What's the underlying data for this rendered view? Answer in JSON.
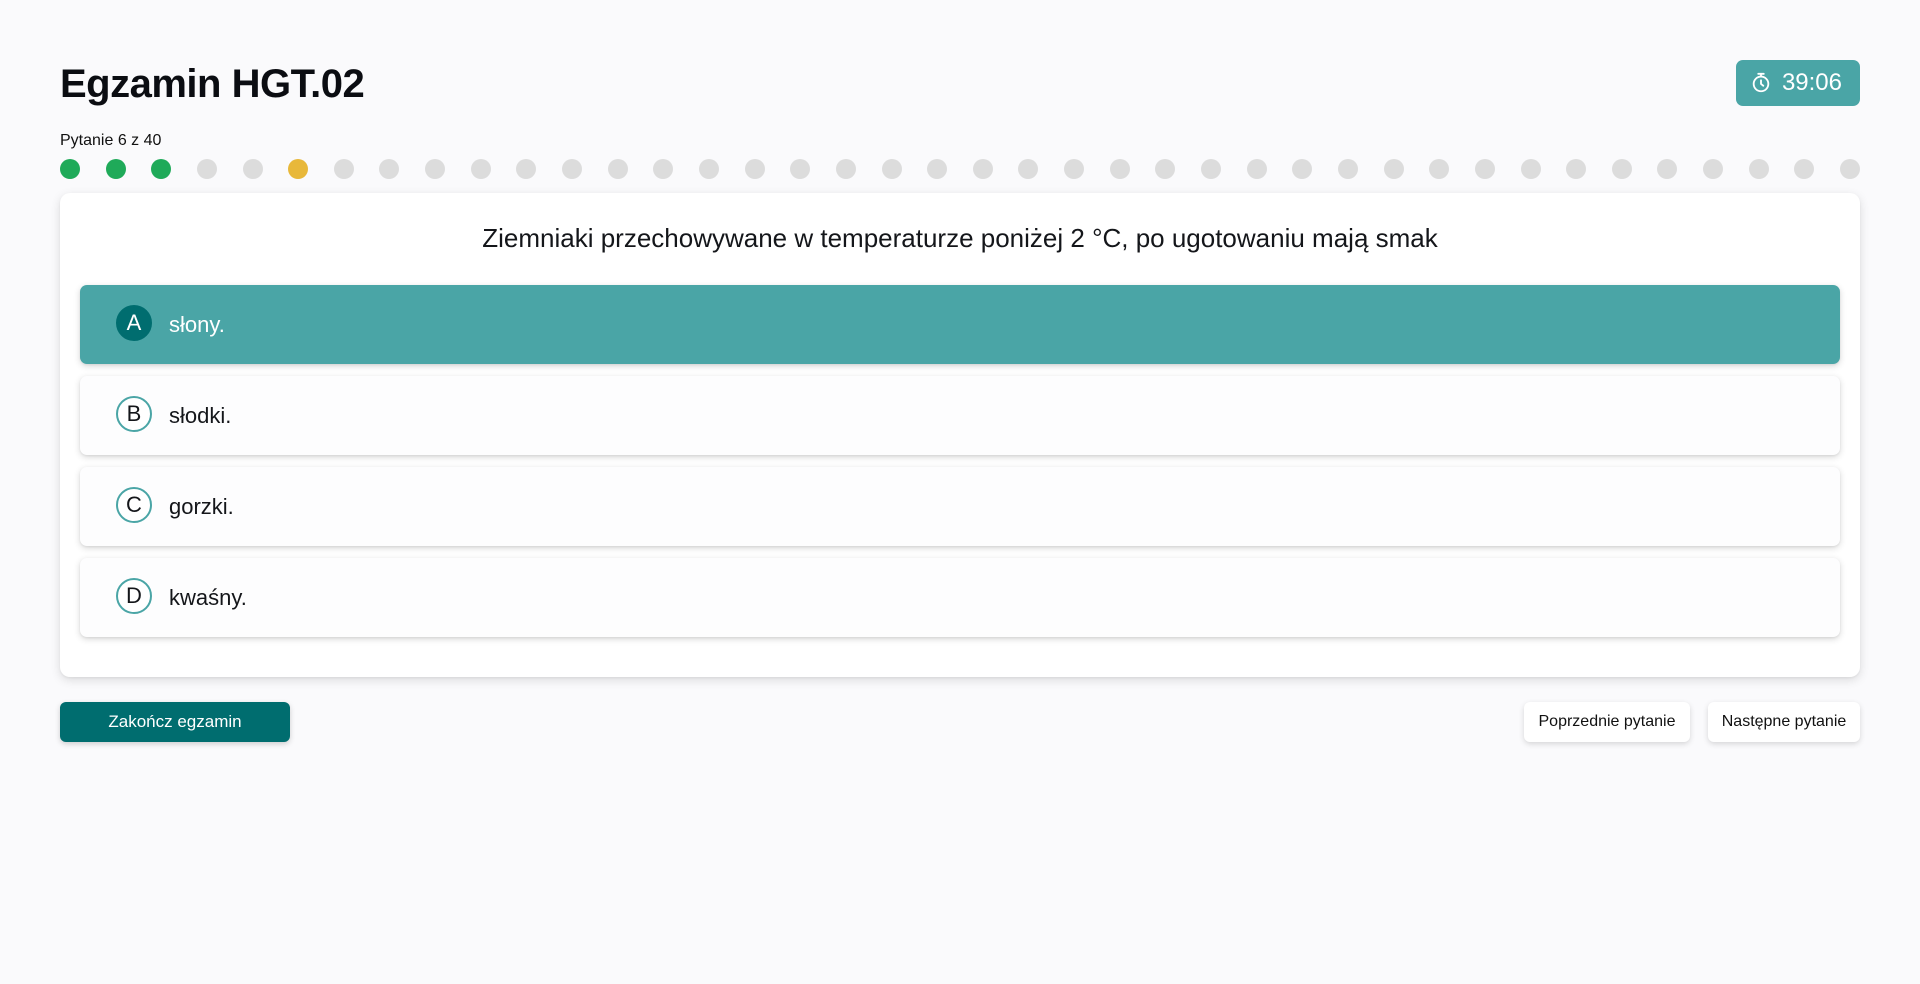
{
  "header": {
    "title": "Egzamin HGT.02",
    "timer": "39:06",
    "timer_icon": "stopwatch-icon"
  },
  "progress": {
    "label": "Pytanie 6 z 40",
    "current": 6,
    "total": 40,
    "answered": [
      1,
      2,
      3
    ],
    "colors": {
      "answered": "#1faa59",
      "current": "#e8b83a",
      "unanswered": "#dcdcdc"
    }
  },
  "question": {
    "text": "Ziemniaki przechowywane w temperaturze poniżej 2 °C, po ugotowaniu mają smak",
    "answers": [
      {
        "letter": "A",
        "text": "słony.",
        "selected": true
      },
      {
        "letter": "B",
        "text": "słodki.",
        "selected": false
      },
      {
        "letter": "C",
        "text": "gorzki.",
        "selected": false
      },
      {
        "letter": "D",
        "text": "kwaśny.",
        "selected": false
      }
    ]
  },
  "footer": {
    "finish_label": "Zakończ egzamin",
    "prev_label": "Poprzednie pytanie",
    "next_label": "Następne pytanie"
  },
  "colors": {
    "accent": "#4aa5a6",
    "primary_dark": "#006d6f",
    "background": "#fafafc"
  }
}
